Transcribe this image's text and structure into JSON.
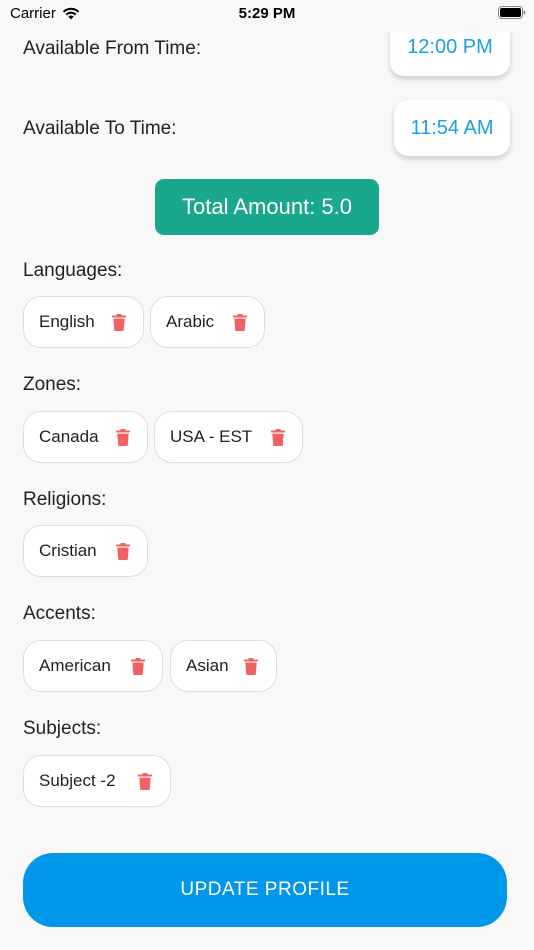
{
  "status_bar": {
    "carrier": "Carrier",
    "time": "5:29 PM"
  },
  "availability": {
    "from_label": "Available From Time:",
    "from_value": "12:00 PM",
    "to_label": "Available To Time:",
    "to_value": "11:54 AM"
  },
  "total": {
    "label": "Total Amount: 5.0"
  },
  "sections": {
    "languages": {
      "label": "Languages:",
      "items": [
        "English",
        "Arabic"
      ]
    },
    "zones": {
      "label": "Zones:",
      "items": [
        "Canada",
        "USA - EST"
      ]
    },
    "religions": {
      "label": "Religions:",
      "items": [
        "Cristian"
      ]
    },
    "accents": {
      "label": "Accents:",
      "items": [
        "American",
        "Asian"
      ]
    },
    "subjects": {
      "label": "Subjects:",
      "items": [
        "Subject -2"
      ]
    }
  },
  "actions": {
    "update_label": "UPDATE PROFILE"
  },
  "colors": {
    "accent_blue": "#0097ea",
    "time_text": "#1ba0e2",
    "total_green": "#1aa88c",
    "trash_red": "#f06262"
  },
  "icons": {
    "chip_remove": "trash-icon",
    "wifi": "wifi-icon",
    "battery": "battery-icon"
  }
}
